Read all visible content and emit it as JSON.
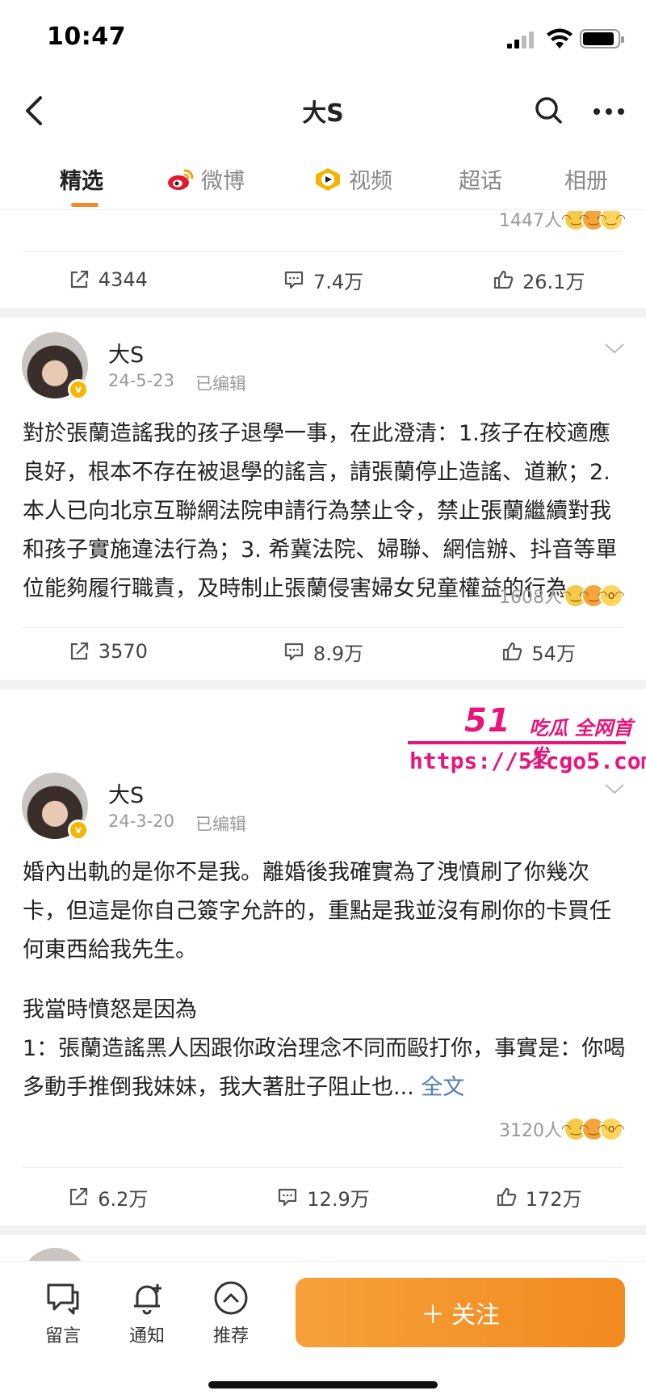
{
  "status": {
    "time": "10:47"
  },
  "nav": {
    "title": "大S"
  },
  "tabs": [
    {
      "label": "精选",
      "active": true
    },
    {
      "label": "微博",
      "active": false
    },
    {
      "label": "视频",
      "active": false
    },
    {
      "label": "超话",
      "active": false
    },
    {
      "label": "相册",
      "active": false
    }
  ],
  "post0": {
    "reaction_count": "1447人",
    "share": "4344",
    "comments": "7.4万",
    "likes": "26.1万"
  },
  "post1": {
    "username": "大S",
    "date": "24-5-23",
    "edited": "已编辑",
    "text": "對於張蘭造謠我的孩子退學一事，在此澄清：1.孩子在校適應良好，根本不存在被退學的謠言，請張蘭停止造謠、道歉；2.本人已向北京互聯網法院申請行為禁止令，禁止張蘭繼續對我和孩子實施違法行為；3. 希冀法院、婦聯、網信辦、抖音等單位能夠履行職責，及時制止張蘭侵害婦女兒童權益的行為。",
    "reaction_count": "1608人",
    "share": "3570",
    "comments": "8.9万",
    "likes": "54万"
  },
  "post2": {
    "username": "大S",
    "date": "24-3-20",
    "edited": "已编辑",
    "text_p1": "婚內出軌的是你不是我。離婚後我確實為了洩憤刷了你幾次卡，但這是你自己簽字允許的，重點是我並沒有刷你的卡買任何東西給我先生。",
    "text_p2": "我當時憤怒是因為\n1：張蘭造謠黑人因跟你政治理念不同而毆打你，事實是：你喝多動手推倒我妹妹，我大著肚子阻止也...",
    "full_text_link": "全文",
    "reaction_count": "3120人",
    "share": "6.2万",
    "comments": "12.9万",
    "likes": "172万"
  },
  "watermark": {
    "logo": "51",
    "tag": "吃瓜 全网首发",
    "url": "https://51cgo5.com"
  },
  "bottom": {
    "message": "留言",
    "notify": "通知",
    "recommend": "推荐",
    "follow": "关注"
  },
  "colors": {
    "accent": "#f38a2a",
    "link": "#507daf",
    "watermark": "#e8147a"
  }
}
